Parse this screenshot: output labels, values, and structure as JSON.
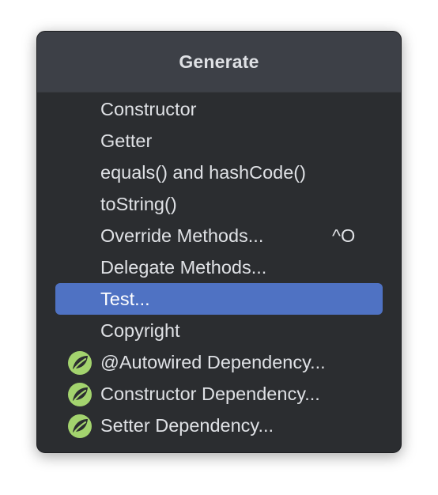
{
  "popup": {
    "title": "Generate",
    "items": [
      {
        "label": "Constructor",
        "shortcut": "",
        "icon": ""
      },
      {
        "label": "Getter",
        "shortcut": "",
        "icon": ""
      },
      {
        "label": "equals() and hashCode()",
        "shortcut": "",
        "icon": ""
      },
      {
        "label": "toString()",
        "shortcut": "",
        "icon": ""
      },
      {
        "label": "Override Methods...",
        "shortcut": "^O",
        "icon": ""
      },
      {
        "label": "Delegate Methods...",
        "shortcut": "",
        "icon": ""
      },
      {
        "label": "Test...",
        "shortcut": "",
        "icon": "",
        "selected": true
      },
      {
        "label": "Copyright",
        "shortcut": "",
        "icon": ""
      },
      {
        "label": "@Autowired Dependency...",
        "shortcut": "",
        "icon": "spring-leaf-icon"
      },
      {
        "label": "Constructor Dependency...",
        "shortcut": "",
        "icon": "spring-leaf-icon"
      },
      {
        "label": "Setter Dependency...",
        "shortcut": "",
        "icon": "spring-leaf-icon"
      }
    ]
  },
  "colors": {
    "background": "#2b2d30",
    "header": "#3d4047",
    "text": "#dfe1e5",
    "selection": "#4f72c3",
    "spring_icon": "#a3d36e"
  }
}
